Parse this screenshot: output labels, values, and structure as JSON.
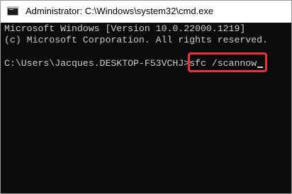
{
  "window": {
    "title": "Administrator: C:\\Windows\\system32\\cmd.exe",
    "icon": "cmd-icon"
  },
  "console": {
    "version_line": "Microsoft Windows [Version 10.0.22000.1219]",
    "copyright_line": "(c) Microsoft Corporation. All rights reserved.",
    "prompt": "C:\\Users\\Jacques.DESKTOP-F53VCHJ>",
    "command": "sfc /scannow"
  },
  "colors": {
    "console_background": "#0c0c0c",
    "console_text": "#cccccc",
    "highlight_border": "#e8333d",
    "titlebar_background": "#ffffff"
  }
}
